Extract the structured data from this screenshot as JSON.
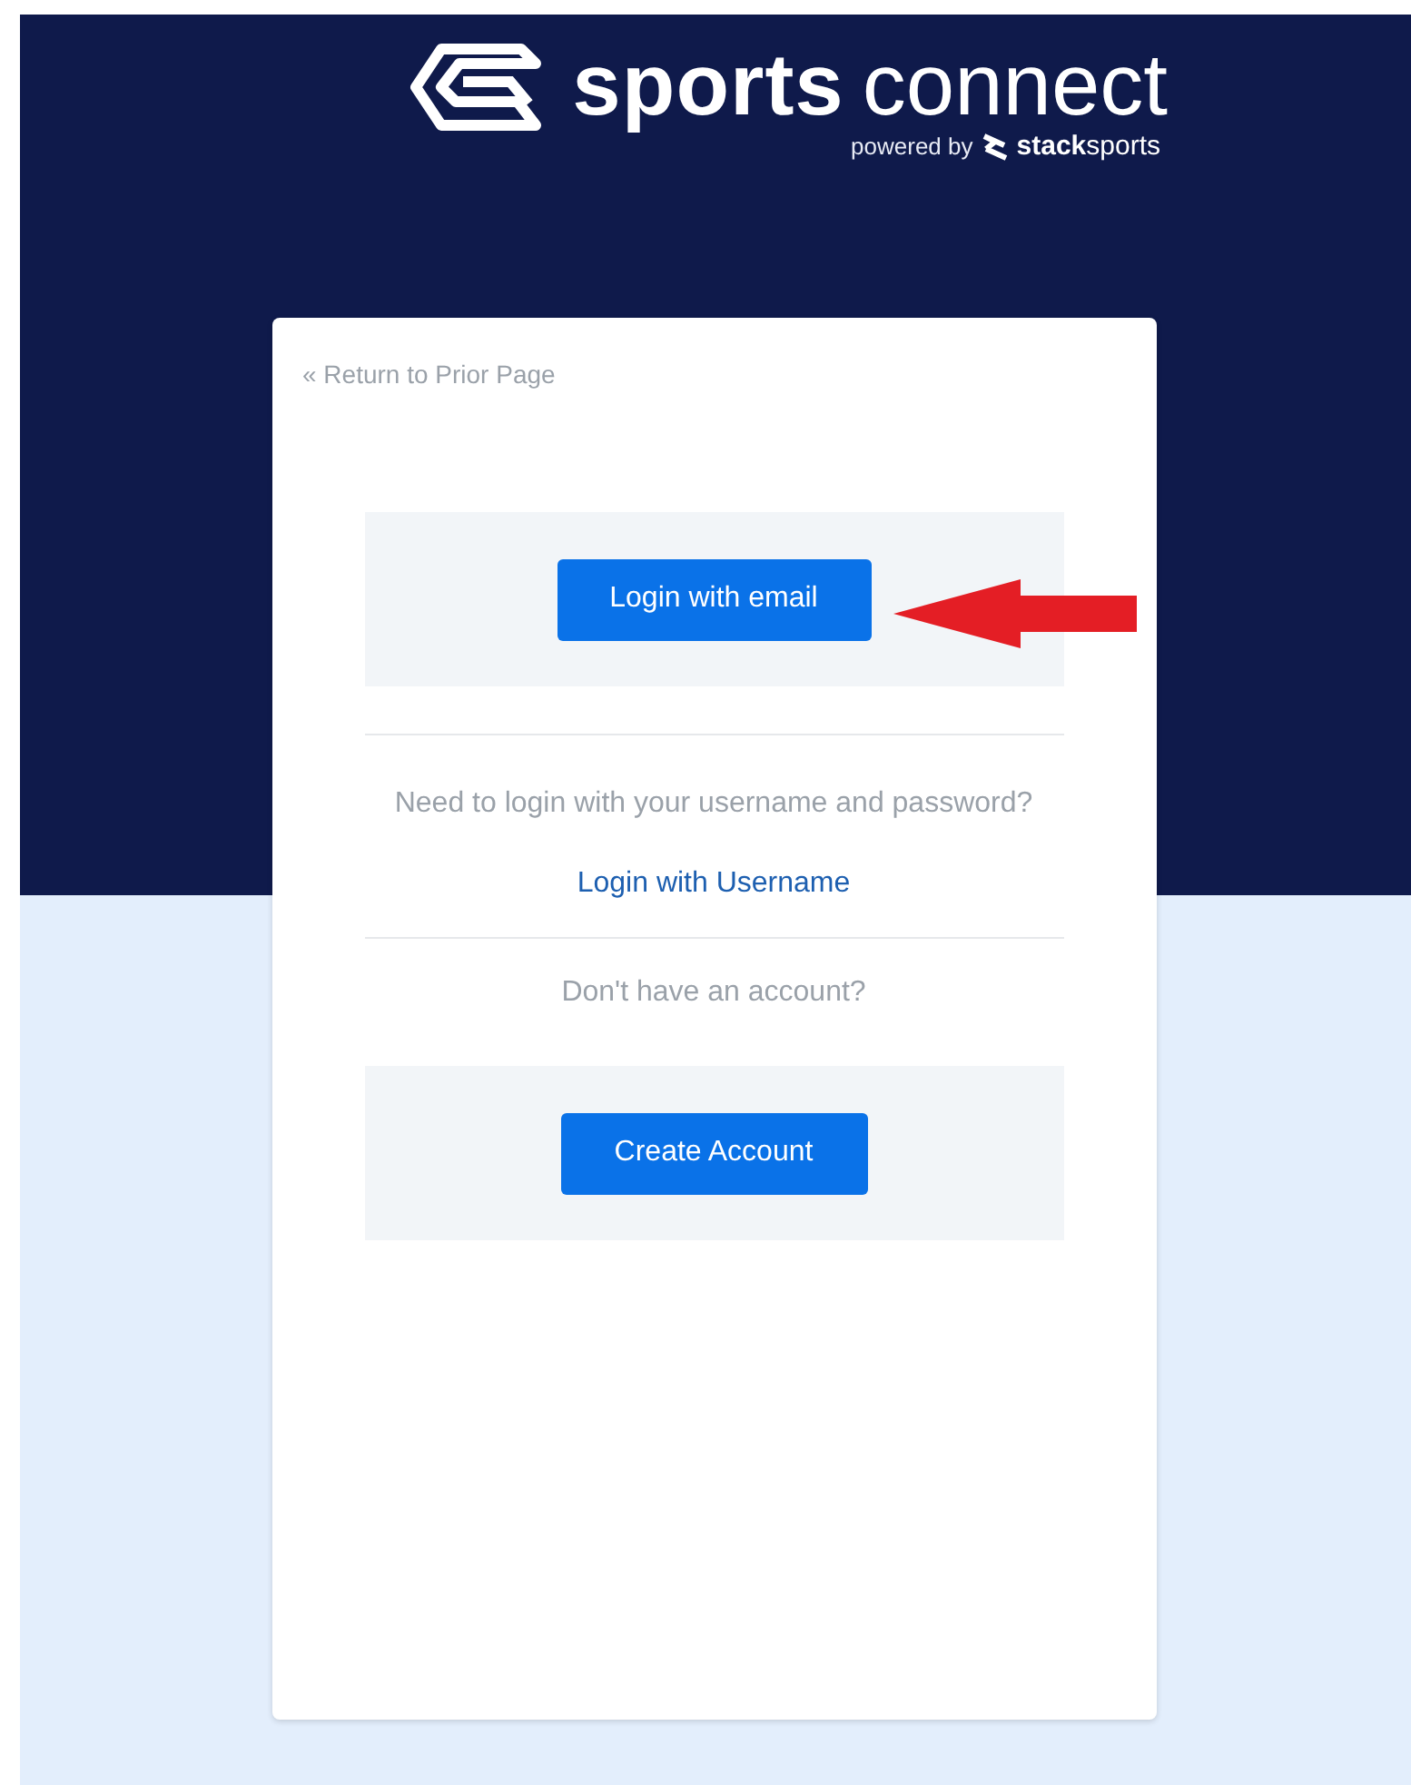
{
  "logo": {
    "word_bold": "sports",
    "word_light": "connect",
    "tagline": "powered by",
    "brand_bold": "stack",
    "brand": "sports"
  },
  "return_link": "« Return to Prior Page",
  "email_login": {
    "button": "Login with email",
    "arrow": true
  },
  "username_prompt": "Need to login with your username and password?",
  "username_link": "Login with Username",
  "account_prompt": "Don't have an account?",
  "create_button": "Create Account"
}
